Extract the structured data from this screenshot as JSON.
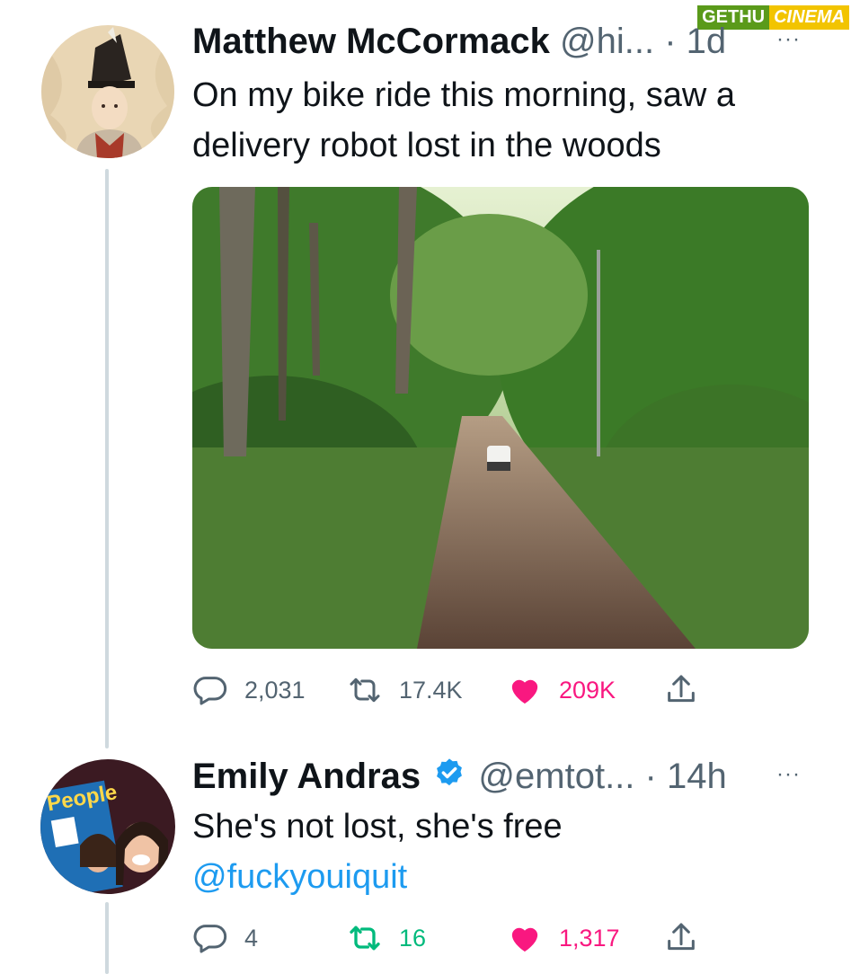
{
  "watermark": {
    "part1": "GETHU",
    "part2": "CINEMA"
  },
  "tweet": {
    "name": "Matthew McCormack",
    "handle": "@hi...",
    "time": "· 1d",
    "more": "···",
    "text": "On my bike ride this morning, saw a delivery robot lost in the woods",
    "stats": {
      "replies": "2,031",
      "retweets": "17.4K",
      "likes": "209K"
    },
    "liked": true
  },
  "reply": {
    "name": "Emily Andras",
    "verified": true,
    "handle": "@emtot...",
    "time": "· 14h",
    "more": "···",
    "text": "She's not lost, she's free",
    "mention": "@fuckyouiquit",
    "stats": {
      "replies": "4",
      "retweets": "16",
      "likes": "1,317"
    },
    "liked": true,
    "retweeted": true
  },
  "colors": {
    "like": "#f91880",
    "retweet": "#00ba7c",
    "link": "#1d9bf0",
    "secondary": "#536471",
    "verified": "#1d9bf0"
  },
  "icons": [
    "reply-icon",
    "retweet-icon",
    "heart-icon",
    "share-icon",
    "verified-icon",
    "more-icon"
  ]
}
